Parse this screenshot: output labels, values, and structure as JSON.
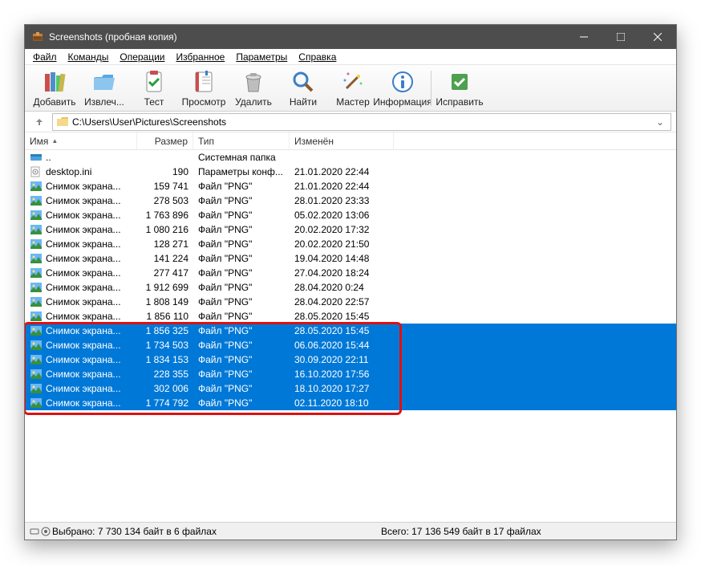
{
  "window": {
    "title": "Screenshots (пробная копия)"
  },
  "menu": {
    "file": "Файл",
    "commands": "Команды",
    "operations": "Операции",
    "favorites": "Избранное",
    "parameters": "Параметры",
    "help": "Справка"
  },
  "toolbar": {
    "add": "Добавить",
    "extract": "Извлеч...",
    "test": "Тест",
    "view": "Просмотр",
    "delete": "Удалить",
    "find": "Найти",
    "wizard": "Мастер",
    "info": "Информация",
    "repair": "Исправить"
  },
  "address": {
    "path": "C:\\Users\\User\\Pictures\\Screenshots"
  },
  "columns": {
    "name": "Имя",
    "size": "Размер",
    "type": "Тип",
    "modified": "Изменён"
  },
  "rows": [
    {
      "icon": "drive",
      "name": "..",
      "size": "",
      "type": "Системная папка",
      "mod": "",
      "sel": false
    },
    {
      "icon": "ini",
      "name": "desktop.ini",
      "size": "190",
      "type": "Параметры конф...",
      "mod": "21.01.2020 22:44",
      "sel": false
    },
    {
      "icon": "img",
      "name": "Снимок экрана...",
      "size": "159 741",
      "type": "Файл \"PNG\"",
      "mod": "21.01.2020 22:44",
      "sel": false
    },
    {
      "icon": "img",
      "name": "Снимок экрана...",
      "size": "278 503",
      "type": "Файл \"PNG\"",
      "mod": "28.01.2020 23:33",
      "sel": false
    },
    {
      "icon": "img",
      "name": "Снимок экрана...",
      "size": "1 763 896",
      "type": "Файл \"PNG\"",
      "mod": "05.02.2020 13:06",
      "sel": false
    },
    {
      "icon": "img",
      "name": "Снимок экрана...",
      "size": "1 080 216",
      "type": "Файл \"PNG\"",
      "mod": "20.02.2020 17:32",
      "sel": false
    },
    {
      "icon": "img",
      "name": "Снимок экрана...",
      "size": "128 271",
      "type": "Файл \"PNG\"",
      "mod": "20.02.2020 21:50",
      "sel": false
    },
    {
      "icon": "img",
      "name": "Снимок экрана...",
      "size": "141 224",
      "type": "Файл \"PNG\"",
      "mod": "19.04.2020 14:48",
      "sel": false
    },
    {
      "icon": "img",
      "name": "Снимок экрана...",
      "size": "277 417",
      "type": "Файл \"PNG\"",
      "mod": "27.04.2020 18:24",
      "sel": false
    },
    {
      "icon": "img",
      "name": "Снимок экрана...",
      "size": "1 912 699",
      "type": "Файл \"PNG\"",
      "mod": "28.04.2020 0:24",
      "sel": false
    },
    {
      "icon": "img",
      "name": "Снимок экрана...",
      "size": "1 808 149",
      "type": "Файл \"PNG\"",
      "mod": "28.04.2020 22:57",
      "sel": false
    },
    {
      "icon": "img",
      "name": "Снимок экрана...",
      "size": "1 856 110",
      "type": "Файл \"PNG\"",
      "mod": "28.05.2020 15:45",
      "sel": false
    },
    {
      "icon": "img",
      "name": "Снимок экрана...",
      "size": "1 856 325",
      "type": "Файл \"PNG\"",
      "mod": "28.05.2020 15:45",
      "sel": true
    },
    {
      "icon": "img",
      "name": "Снимок экрана...",
      "size": "1 734 503",
      "type": "Файл \"PNG\"",
      "mod": "06.06.2020 15:44",
      "sel": true
    },
    {
      "icon": "img",
      "name": "Снимок экрана...",
      "size": "1 834 153",
      "type": "Файл \"PNG\"",
      "mod": "30.09.2020 22:11",
      "sel": true
    },
    {
      "icon": "img",
      "name": "Снимок экрана...",
      "size": "228 355",
      "type": "Файл \"PNG\"",
      "mod": "16.10.2020 17:56",
      "sel": true
    },
    {
      "icon": "img",
      "name": "Снимок экрана...",
      "size": "302 006",
      "type": "Файл \"PNG\"",
      "mod": "18.10.2020 17:27",
      "sel": true
    },
    {
      "icon": "img",
      "name": "Снимок экрана...",
      "size": "1 774 792",
      "type": "Файл \"PNG\"",
      "mod": "02.11.2020 18:10",
      "sel": true
    }
  ],
  "status": {
    "selected": "Выбрано: 7 730 134 байт в 6 файлах",
    "total": "Всего: 17 136 549 байт в 17 файлах"
  }
}
